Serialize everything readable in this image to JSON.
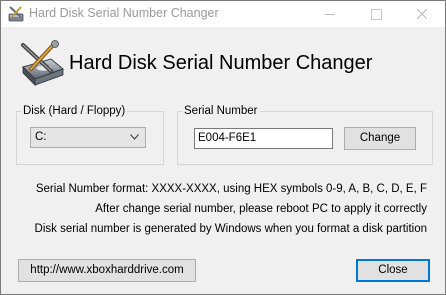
{
  "window": {
    "title": "Hard Disk Serial Number Changer",
    "controls": {
      "minimize": "minimize",
      "maximize": "maximize",
      "close": "close"
    }
  },
  "header": {
    "title": "Hard Disk Serial Number Changer"
  },
  "disk_group": {
    "legend": "Disk (Hard / Floppy)",
    "selected_drive": "C:"
  },
  "serial_group": {
    "legend": "Serial Number",
    "value": "E004-F6E1",
    "change_label": "Change"
  },
  "info": {
    "line1": "Serial Number format: XXXX-XXXX, using HEX symbols 0-9, A, B, C, D, E, F",
    "line2": "After change serial number, please reboot PC to apply it correctly",
    "line3": "Disk serial number is generated by Windows when you format a disk partition"
  },
  "footer": {
    "url_label": "http://www.xboxharddrive.com",
    "close_label": "Close"
  },
  "colors": {
    "accent": "#0078d7",
    "background": "#f0f0f0"
  }
}
